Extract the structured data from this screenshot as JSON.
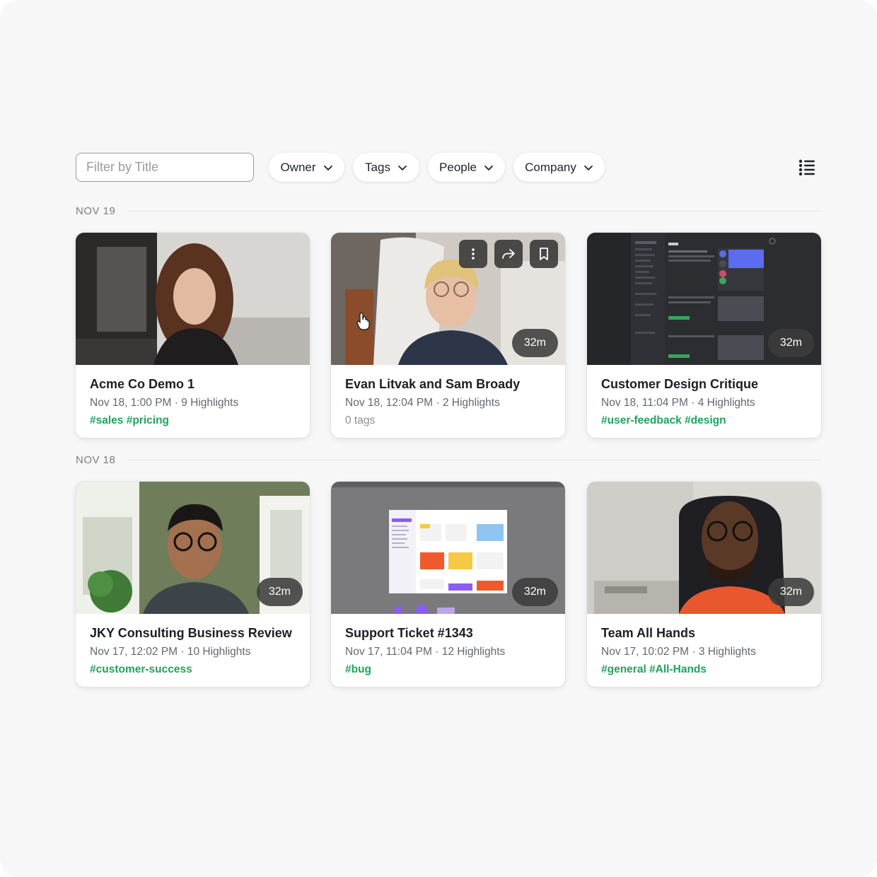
{
  "filter": {
    "placeholder": "Filter by Title"
  },
  "filters": [
    {
      "label": "Owner"
    },
    {
      "label": "Tags"
    },
    {
      "label": "People"
    },
    {
      "label": "Company"
    }
  ],
  "view_toggle_icon": "list-view-icon",
  "sections": [
    {
      "date": "NOV 19",
      "cards": [
        {
          "title": "Acme Co Demo 1",
          "meta": "Nov 18, 1:00 PM · 9 Highlights",
          "tags": "#sales #pricing",
          "duration": ""
        },
        {
          "title": "Evan Litvak and Sam Broady",
          "meta": "Nov 18, 12:04 PM · 2 Highlights",
          "tags": "0 tags",
          "duration": "32m"
        },
        {
          "title": "Customer Design Critique",
          "meta": "Nov 18, 11:04 PM · 4 Highlights",
          "tags": "#user-feedback #design",
          "duration": "32m"
        }
      ]
    },
    {
      "date": "NOV 18",
      "cards": [
        {
          "title": "JKY Consulting Business Review",
          "meta": "Nov 17, 12:02 PM · 10 Highlights",
          "tags": "#customer-success",
          "duration": "32m"
        },
        {
          "title": "Support Ticket #1343",
          "meta": "Nov 17, 11:04 PM · 12 Highlights",
          "tags": "#bug",
          "duration": "32m"
        },
        {
          "title": "Team All Hands",
          "meta": "Nov 17, 10:02 PM · 3 Highlights",
          "tags": "#general #All-Hands",
          "duration": "32m"
        }
      ]
    }
  ],
  "hover_actions": [
    "more-icon",
    "share-icon",
    "bookmark-icon"
  ],
  "colors": {
    "tag": "#21a35c",
    "badge": "#3c3c3c",
    "background": "#f7f7f7"
  }
}
